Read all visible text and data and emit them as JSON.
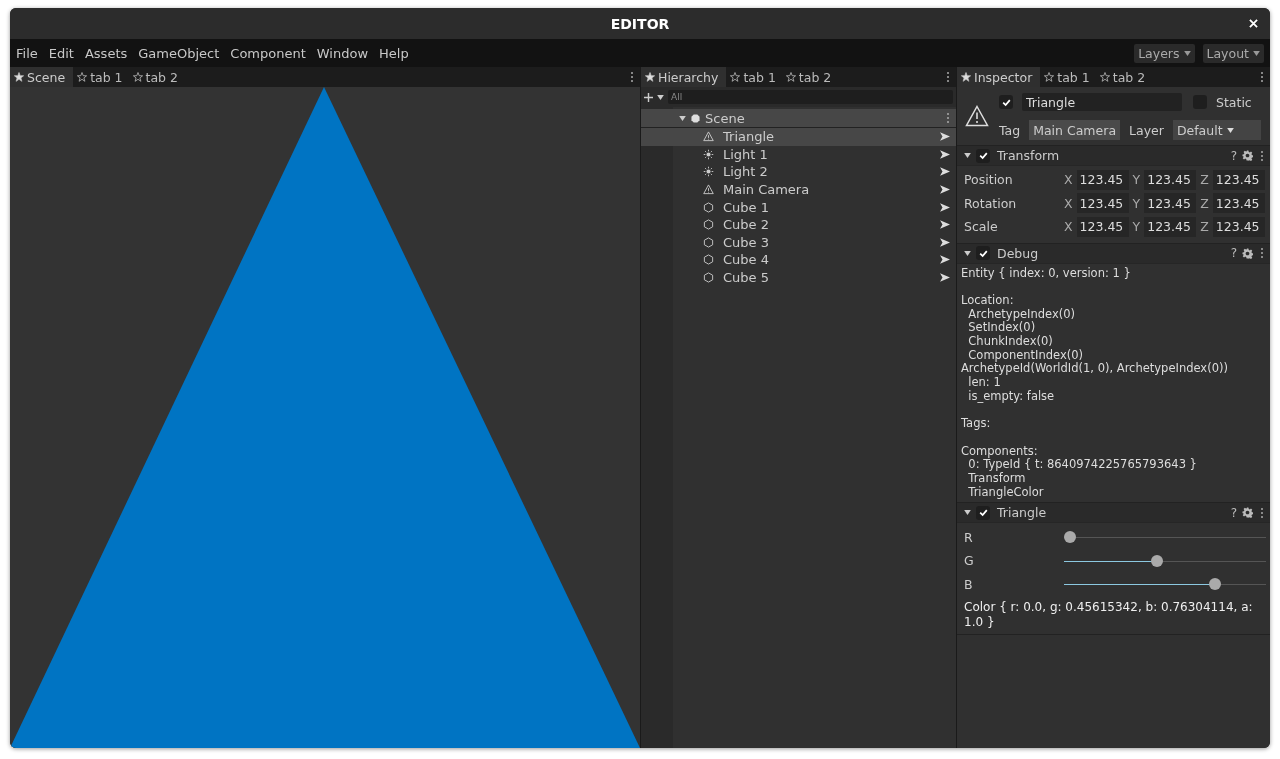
{
  "window": {
    "title": "EDITOR"
  },
  "menu": [
    "File",
    "Edit",
    "Assets",
    "GameObject",
    "Component",
    "Window",
    "Help"
  ],
  "toolbar_buttons": [
    "Layers",
    "Layout"
  ],
  "scene_panel": {
    "tabs": [
      {
        "label": "Scene",
        "selected": true
      },
      {
        "label": "tab 1",
        "selected": false
      },
      {
        "label": "tab 2",
        "selected": false
      }
    ]
  },
  "hierarchy": {
    "tabs": [
      {
        "label": "Hierarchy",
        "selected": true
      },
      {
        "label": "tab 1",
        "selected": false
      },
      {
        "label": "tab 2",
        "selected": false
      }
    ],
    "filter": {
      "placeholder": "All"
    },
    "root": {
      "label": "Scene",
      "expanded": true,
      "children": [
        {
          "label": "Triangle",
          "kind": "warning",
          "selected": true
        },
        {
          "label": "Light 1",
          "kind": "light",
          "selected": false
        },
        {
          "label": "Light 2",
          "kind": "light",
          "selected": false
        },
        {
          "label": "Main Camera",
          "kind": "warning",
          "selected": false
        },
        {
          "label": "Cube 1",
          "kind": "cube",
          "selected": false
        },
        {
          "label": "Cube 2",
          "kind": "cube",
          "selected": false
        },
        {
          "label": "Cube 3",
          "kind": "cube",
          "selected": false
        },
        {
          "label": "Cube 4",
          "kind": "cube",
          "selected": false
        },
        {
          "label": "Cube 5",
          "kind": "cube",
          "selected": false
        }
      ]
    }
  },
  "inspector": {
    "tabs": [
      {
        "label": "Inspector",
        "selected": true
      },
      {
        "label": "tab 1",
        "selected": false
      },
      {
        "label": "tab 2",
        "selected": false
      }
    ],
    "object": {
      "enabled": true,
      "name": "Triangle",
      "static": false,
      "static_label": "Static",
      "tag_label": "Tag",
      "tag": "Main Camera",
      "layer_label": "Layer",
      "layer": "Default"
    },
    "components": [
      {
        "kind": "transform",
        "title": "Transform",
        "expanded": true,
        "enabled": true,
        "help": "?",
        "rows": [
          {
            "label": "Position",
            "values": [
              {
                "axis": "X",
                "value": "123.45"
              },
              {
                "axis": "Y",
                "value": "123.45"
              },
              {
                "axis": "Z",
                "value": "123.45"
              }
            ]
          },
          {
            "label": "Rotation",
            "values": [
              {
                "axis": "X",
                "value": "123.45"
              },
              {
                "axis": "Y",
                "value": "123.45"
              },
              {
                "axis": "Z",
                "value": "123.45"
              }
            ]
          },
          {
            "label": "Scale",
            "values": [
              {
                "axis": "X",
                "value": "123.45"
              },
              {
                "axis": "Y",
                "value": "123.45"
              },
              {
                "axis": "Z",
                "value": "123.45"
              }
            ]
          }
        ]
      },
      {
        "kind": "text",
        "title": "Debug",
        "expanded": true,
        "enabled": true,
        "help": "?",
        "text": "Entity { index: 0, version: 1 }\n\nLocation:\n  ArchetypeIndex(0)\n  SetIndex(0)\n  ChunkIndex(0)\n  ComponentIndex(0)\nArchetypeId(WorldId(1, 0), ArchetypeIndex(0))\n  len: 1\n  is_empty: false\n\nTags:\n\nComponents:\n  0: TypeId { t: 8640974225765793643 }\n  Transform\n  TriangleColor"
      },
      {
        "kind": "sliders",
        "title": "Triangle",
        "expanded": true,
        "enabled": true,
        "help": "?",
        "sliders": [
          {
            "label": "R",
            "level": 0.0
          },
          {
            "label": "G",
            "level": 0.456
          },
          {
            "label": "B",
            "level": 0.763
          }
        ],
        "text": "Color { r: 0.0, g: 0.45615342, b: 0.76304114, a: 1.0 }"
      }
    ]
  }
}
